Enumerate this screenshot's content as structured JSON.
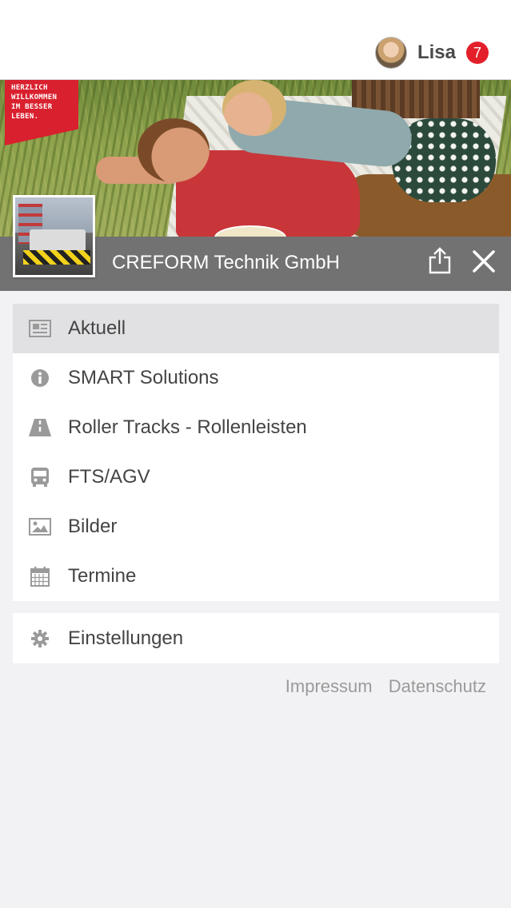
{
  "header": {
    "user_name": "Lisa",
    "notification_count": "7"
  },
  "hero": {
    "promo_lines": [
      "HERZLICH",
      "WILLKOMMEN",
      "IM BESSER",
      "LEBEN."
    ]
  },
  "title_bar": {
    "company_name": "CREFORM Technik GmbH",
    "share_icon": "share-icon",
    "close_icon": "close-icon"
  },
  "menu": {
    "items": [
      {
        "label": "Aktuell",
        "icon": "newspaper-icon",
        "active": true
      },
      {
        "label": "SMART Solutions",
        "icon": "info-icon",
        "active": false
      },
      {
        "label": "Roller Tracks - Rollenleisten",
        "icon": "road-icon",
        "active": false
      },
      {
        "label": "FTS/AGV",
        "icon": "bus-icon",
        "active": false
      },
      {
        "label": "Bilder",
        "icon": "image-icon",
        "active": false
      },
      {
        "label": "Termine",
        "icon": "calendar-icon",
        "active": false
      }
    ]
  },
  "settings": {
    "label": "Einstellungen",
    "icon": "gear-icon"
  },
  "footer": {
    "impressum": "Impressum",
    "datenschutz": "Datenschutz"
  },
  "colors": {
    "accent": "#e3202a",
    "title_bar": "#727272",
    "active_item": "#e1e1e3",
    "background": "#f2f2f4"
  }
}
